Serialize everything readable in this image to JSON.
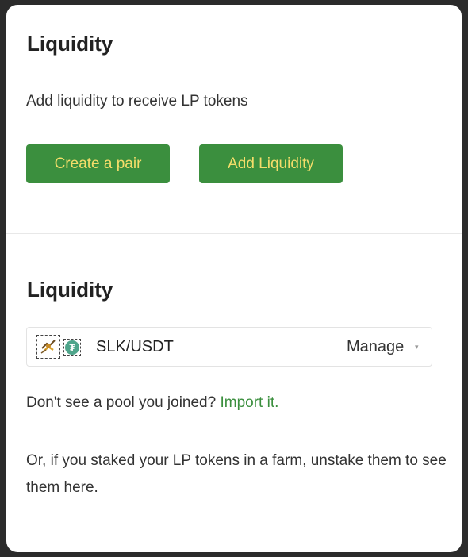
{
  "top_section": {
    "title": "Liquidity",
    "subtitle": "Add liquidity to receive LP tokens",
    "create_pair_label": "Create a pair",
    "add_liquidity_label": "Add Liquidity"
  },
  "positions_section": {
    "title": "Liquidity",
    "pairs": [
      {
        "token0_icon": "slk-token-icon",
        "token1_icon": "usdt-token-icon",
        "token1_symbol_glyph": "₮",
        "name": "SLK/USDT",
        "action_label": "Manage",
        "caret": "▾"
      }
    ],
    "missing_pool_text": "Don't see a pool you joined?",
    "import_link": "Import it.",
    "staked_note": "Or, if you staked your LP tokens in a farm, unstake them to see them here."
  },
  "colors": {
    "button_bg": "#3b8f3e",
    "button_text": "#f5dd6a",
    "link": "#3b8f3e",
    "usdt": "#4ea58b"
  }
}
